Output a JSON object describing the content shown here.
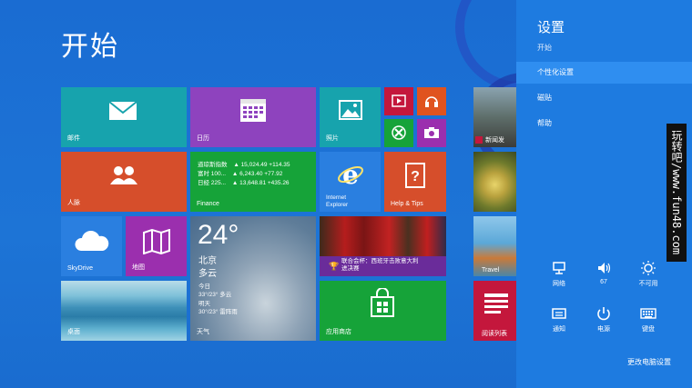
{
  "start": {
    "title": "开始",
    "tiles": {
      "mail": "邮件",
      "calendar": "日历",
      "photos": "照片",
      "people": "人脉",
      "finance": {
        "label": "Finance",
        "rows": [
          {
            "name": "道琼斯指数",
            "arrow": "▲",
            "value": "15,024.49",
            "change": "+114.35"
          },
          {
            "name": "富时 100...",
            "arrow": "▲",
            "value": "6,243.40",
            "change": "+77.92"
          },
          {
            "name": "日经 225...",
            "arrow": "▲",
            "value": "13,648.81",
            "change": "+435.26"
          }
        ]
      },
      "ie": {
        "line1": "Internet",
        "line2": "Explorer"
      },
      "help": "Help & Tips",
      "skydrive": "SkyDrive",
      "maps": "地图",
      "weather": {
        "temp": "24°",
        "city": "北京",
        "condition": "多云",
        "today_label": "今日",
        "today_value": "33°/23° 多云",
        "tomorrow_label": "明天",
        "tomorrow_value": "30°/23° 雷阵雨",
        "label": "天气"
      },
      "sports": "联合会杯：西班牙击败意大利\n进决赛",
      "desktop": "桌面",
      "store": "应用商店",
      "news": "新闻发",
      "travel": "Travel",
      "reading": "阅读列表"
    }
  },
  "charms": {
    "title": "设置",
    "subtitle": "开始",
    "menu": [
      "个性化设置",
      "磁贴",
      "帮助"
    ],
    "quick": [
      {
        "label": "网络",
        "icon": "network-icon",
        "glyph": "⊤"
      },
      {
        "label": "67",
        "icon": "volume-icon",
        "glyph": "🔈"
      },
      {
        "label": "不可用",
        "icon": "brightness-icon",
        "glyph": "☼"
      },
      {
        "label": "通知",
        "icon": "notifications-icon",
        "glyph": "▭"
      },
      {
        "label": "电源",
        "icon": "power-icon",
        "glyph": "⏻"
      },
      {
        "label": "键盘",
        "icon": "keyboard-icon",
        "glyph": "⌨"
      }
    ],
    "change_pc": "更改电脑设置"
  },
  "watermark": "玩转吧/www.fun48.com",
  "colors": {
    "background": "#1e6fd0",
    "charms": "#1e7be0",
    "mail": "#17a3ad",
    "calendar": "#8e43be",
    "photos": "#17a3ad",
    "people": "#d64e2b",
    "finance": "#16a339",
    "ie": "#2a7fe0",
    "help": "#d64e2b",
    "skydrive": "#2a7fe0",
    "maps": "#9b2fae",
    "store": "#16a339"
  }
}
